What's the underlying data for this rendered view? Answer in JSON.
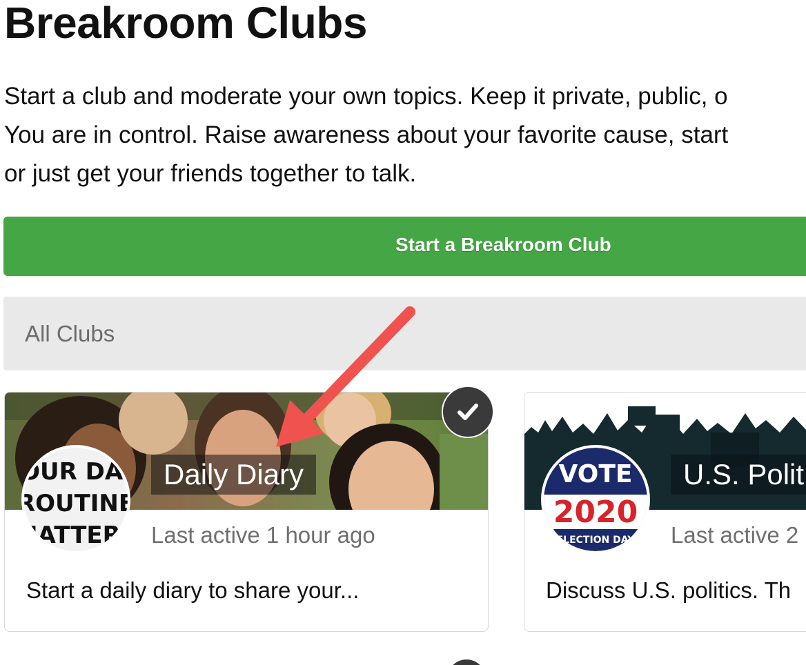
{
  "header": {
    "title": "Breakroom Clubs",
    "intro_lines": [
      "Start a club and moderate your own topics. Keep it private, public, o",
      "You are in control. Raise awareness about your favorite cause, start",
      "or just get your friends together to talk."
    ]
  },
  "actions": {
    "start_club_label": "Start a Breakroom Club"
  },
  "filter": {
    "label": "All Clubs"
  },
  "clubs": [
    {
      "name": "Daily Diary",
      "avatar_text_lines": [
        "OUR DAI",
        "ROUTINE",
        "MATTERS"
      ],
      "last_active": "Last active 1 hour ago",
      "description": "Start a daily diary to share your...",
      "joined": true
    },
    {
      "name": "U.S. Polit",
      "avatar_text_lines": [
        "VOTE",
        "2020",
        "ELECTION DAY"
      ],
      "last_active": "Last active 2",
      "description": "Discuss U.S. politics. Th"
    }
  ],
  "icons": {
    "joined": "checkmark-icon",
    "annotation": "arrow-icon"
  },
  "colors": {
    "primary_button": "#45a645",
    "filter_bar": "#e9e9e9",
    "annotation_arrow": "#f0534f",
    "badge": "#3a3a3a"
  }
}
